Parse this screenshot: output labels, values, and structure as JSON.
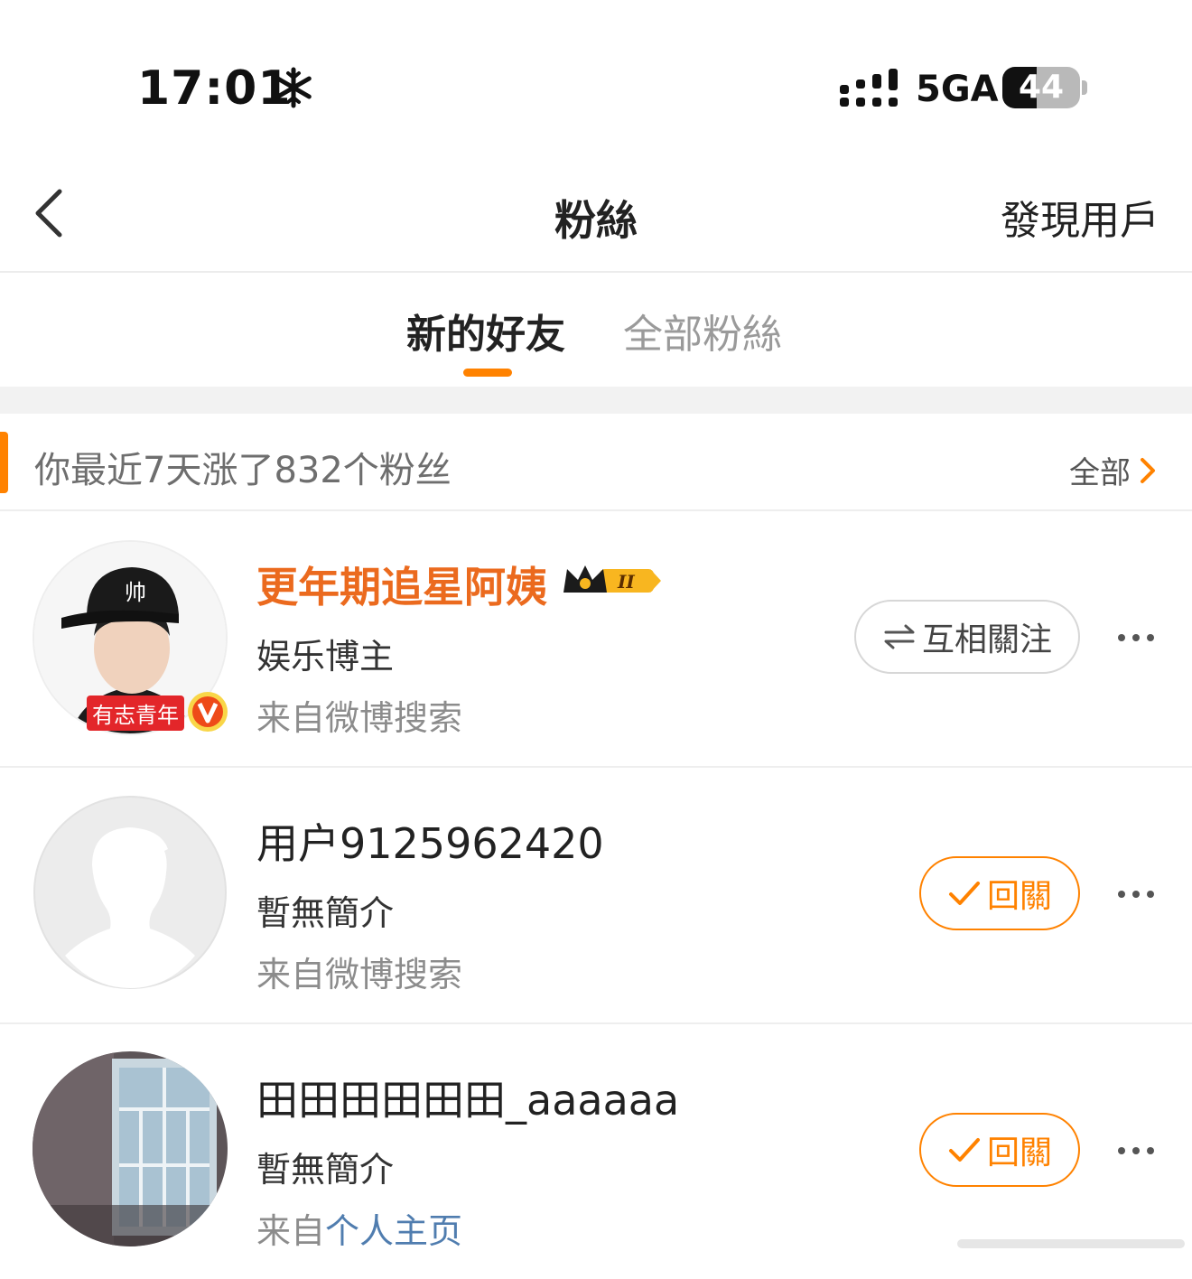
{
  "status_bar": {
    "time": "17:01",
    "network": "5GA",
    "battery": "44",
    "battery_level_percent": 44
  },
  "nav": {
    "title": "粉絲",
    "right_action": "發現用戶"
  },
  "tabs": [
    {
      "label": "新的好友",
      "active": true
    },
    {
      "label": "全部粉絲",
      "active": false
    }
  ],
  "summary": {
    "text": "你最近7天涨了832个粉丝",
    "all_label": "全部"
  },
  "fans": [
    {
      "name": "更年期追星阿姨",
      "description": "娱乐博主",
      "source_prefix": "来自",
      "source": "微博搜索",
      "avatar_badge": "有志青年",
      "cap_text": "帅",
      "vip_level": "II",
      "button": "互相關注"
    },
    {
      "name": "用户9125962420",
      "description": "暫無簡介",
      "source_prefix": "来自",
      "source": "微博搜索",
      "button": "回關"
    },
    {
      "name": "田田田田田田_aaaaaa",
      "description": "暫無簡介",
      "source_prefix": "来自",
      "source": "个人主页",
      "button": "回關"
    }
  ],
  "colors": {
    "accent": "#ff8200",
    "vip_name": "#eb6a1e",
    "link": "#507daf"
  }
}
